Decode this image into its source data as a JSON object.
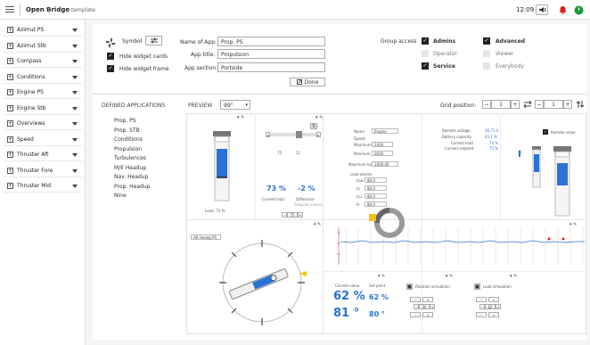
{
  "topbar": {
    "app_name": "Open Bridge",
    "app_sub": "template",
    "time": "12:09"
  },
  "colors": {
    "accent": "#2a72d5",
    "alarm": "#e02020",
    "ok": "#1a9a3a",
    "highlight_yellow": "#f5c400"
  },
  "sidebar": {
    "items": [
      {
        "label": "Azimut PS"
      },
      {
        "label": "Azimut Stb"
      },
      {
        "label": "Compass"
      },
      {
        "label": "Conditions"
      },
      {
        "label": "Engine PS"
      },
      {
        "label": "Engine Stb"
      },
      {
        "label": "Overviews"
      },
      {
        "label": "Speed"
      },
      {
        "label": "Thruster Aft"
      },
      {
        "label": "Thruster Fore"
      },
      {
        "label": "Thruster Mid"
      }
    ]
  },
  "config": {
    "symbol_label": "Symbol",
    "hide_cards": "Hide widget cards",
    "hide_frame": "Hide widget frame",
    "name_label": "Name of App:",
    "name_value": "Prop. PS",
    "title_label": "App title:",
    "title_value": "Propulsion",
    "section_label": "App section:",
    "section_value": "Portside",
    "done": "Done",
    "group_access": "Group access",
    "groups": [
      "Admins",
      "Operator",
      "Service",
      "Advanced",
      "Viewer",
      "Everybody"
    ]
  },
  "defined": {
    "header": "DEFINED APPLICATIONS",
    "items": [
      "Prop. PS",
      "Prop. STB",
      "Conditions",
      "Propulsion",
      "Turbulences",
      "M/E Headup",
      "Nav. Headup",
      "Prop. Headup",
      "Nine"
    ]
  },
  "preview": {
    "label": "PREVIEW",
    "zoom": "99°",
    "grid_label": "Grid position:",
    "grid_x": "1",
    "grid_y": "1"
  },
  "widgets": {
    "load_label": "Load: 73 %",
    "nav_values": [
      "75",
      "11"
    ],
    "curr_load_val": "73 %",
    "curr_load_lbl": "Current load",
    "diff_val": "-2 %",
    "diff_lbl": "Difference",
    "diff_sub": "Setpoint values",
    "step_val": "75",
    "form_labels": [
      "Name",
      "Speed",
      "Maximum",
      "Minimum",
      "Maximum load",
      "Load alarms"
    ],
    "form_values": [
      "Engine",
      "1000",
      "0000",
      "1000.00"
    ],
    "alarm_labels": [
      "Low",
      "LL",
      "LLL",
      "H"
    ],
    "alarm_values": [
      "80.0",
      "80.0",
      "80.0",
      "80.0"
    ],
    "right_labels": [
      "Remote voltage",
      "Battery capacity",
      "Current load",
      "Current setpoint"
    ],
    "right_values": [
      "26.71 V",
      "63.1 %",
      "73 %",
      "75 %"
    ],
    "remote_value": "Remote value",
    "ar_label": "AR Headg PS",
    "curr_value_lbl": "Current value",
    "setpoint_lbl": "Set-point",
    "val62": "62 %",
    "val62b": "62 %",
    "val81": "81 °",
    "val80": "80 °",
    "rot_lbl": "Rotation simulation",
    "load_sim_lbl": "Load simulation",
    "sim_val": "30",
    "load_sim_val": "62"
  }
}
